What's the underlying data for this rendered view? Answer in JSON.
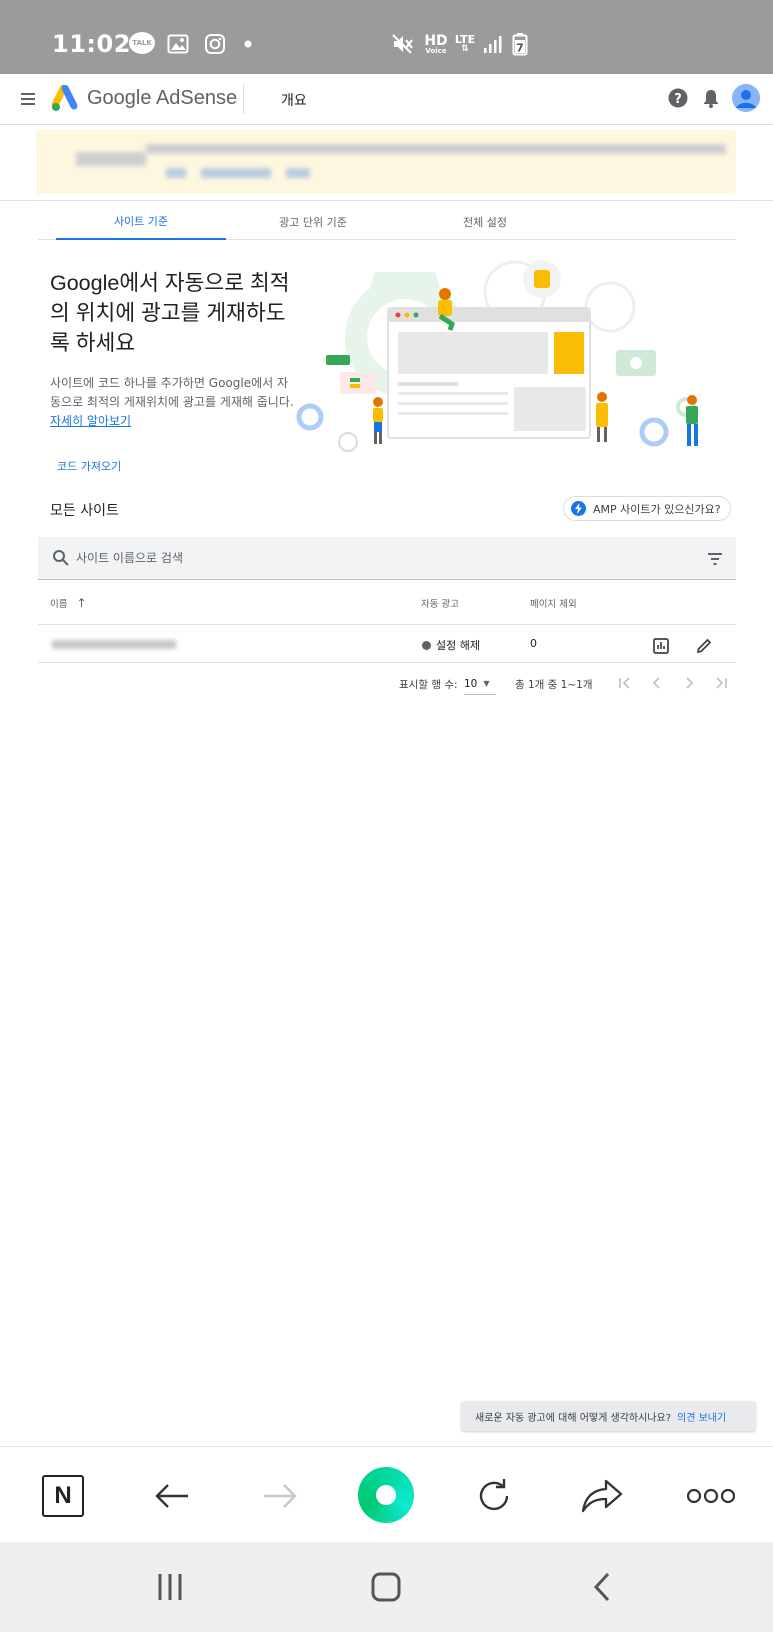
{
  "status_bar": {
    "time": "11:02",
    "talk_label": "TALK",
    "hd_label": "HD",
    "voice_label": "Voice",
    "lte_label": "LTE",
    "battery_level": "7",
    "icons": [
      "talk-icon",
      "gallery-icon",
      "instagram-icon",
      "dot-icon",
      "mute-icon",
      "hd-voice-icon",
      "lte-icon",
      "signal-icon",
      "battery-icon"
    ]
  },
  "appbar": {
    "product_name": "Google AdSense",
    "section": "개요",
    "icons": [
      "menu-icon",
      "adsense-logo",
      "help-icon",
      "bell-icon",
      "avatar"
    ]
  },
  "tabs": [
    {
      "label": "사이트 기준",
      "active": true
    },
    {
      "label": "광고 단위 기준",
      "active": false
    },
    {
      "label": "전체 설정",
      "active": false
    }
  ],
  "hero": {
    "title": "Google에서 자동으로 최적의 위치에 광고를 게재하도록 하세요",
    "description": "사이트에 코드 하나를 추가하면 Google에서 자동으로 최적의 게재위치에 광고를 게재해 줍니다.",
    "learn_more": "자세히 알아보기",
    "get_code": "코드 가져오기"
  },
  "sites": {
    "title": "모든 사이트",
    "amp_chip": "AMP 사이트가 있으신가요?",
    "search_placeholder": "사이트 이름으로 검색",
    "columns": {
      "name": "이름",
      "auto_ads": "자동 광고",
      "excluded_pages": "페이지 제외"
    },
    "rows": [
      {
        "auto_ads": "설정 해제",
        "excluded_pages": "0"
      }
    ],
    "pagination": {
      "rows_per_page_label": "표시할 행 수:",
      "rows_per_page": "10",
      "range": "총 1개 중 1~1개"
    }
  },
  "feedback": {
    "text": "새로운 자동 광고에 대해 어떻게 생각하시나요?",
    "link": "의견 보내기"
  },
  "browser_toolbar": {
    "naver_label": "N",
    "icons": [
      "naver-home-icon",
      "back-arrow-icon",
      "forward-arrow-icon",
      "green-dot-icon",
      "reload-icon",
      "share-icon",
      "more-icon"
    ]
  },
  "colors": {
    "accent": "#1a73e8",
    "status_bar": "#9b9b9b",
    "banner": "#fdf7df",
    "search_bg": "#f1f3f4"
  }
}
